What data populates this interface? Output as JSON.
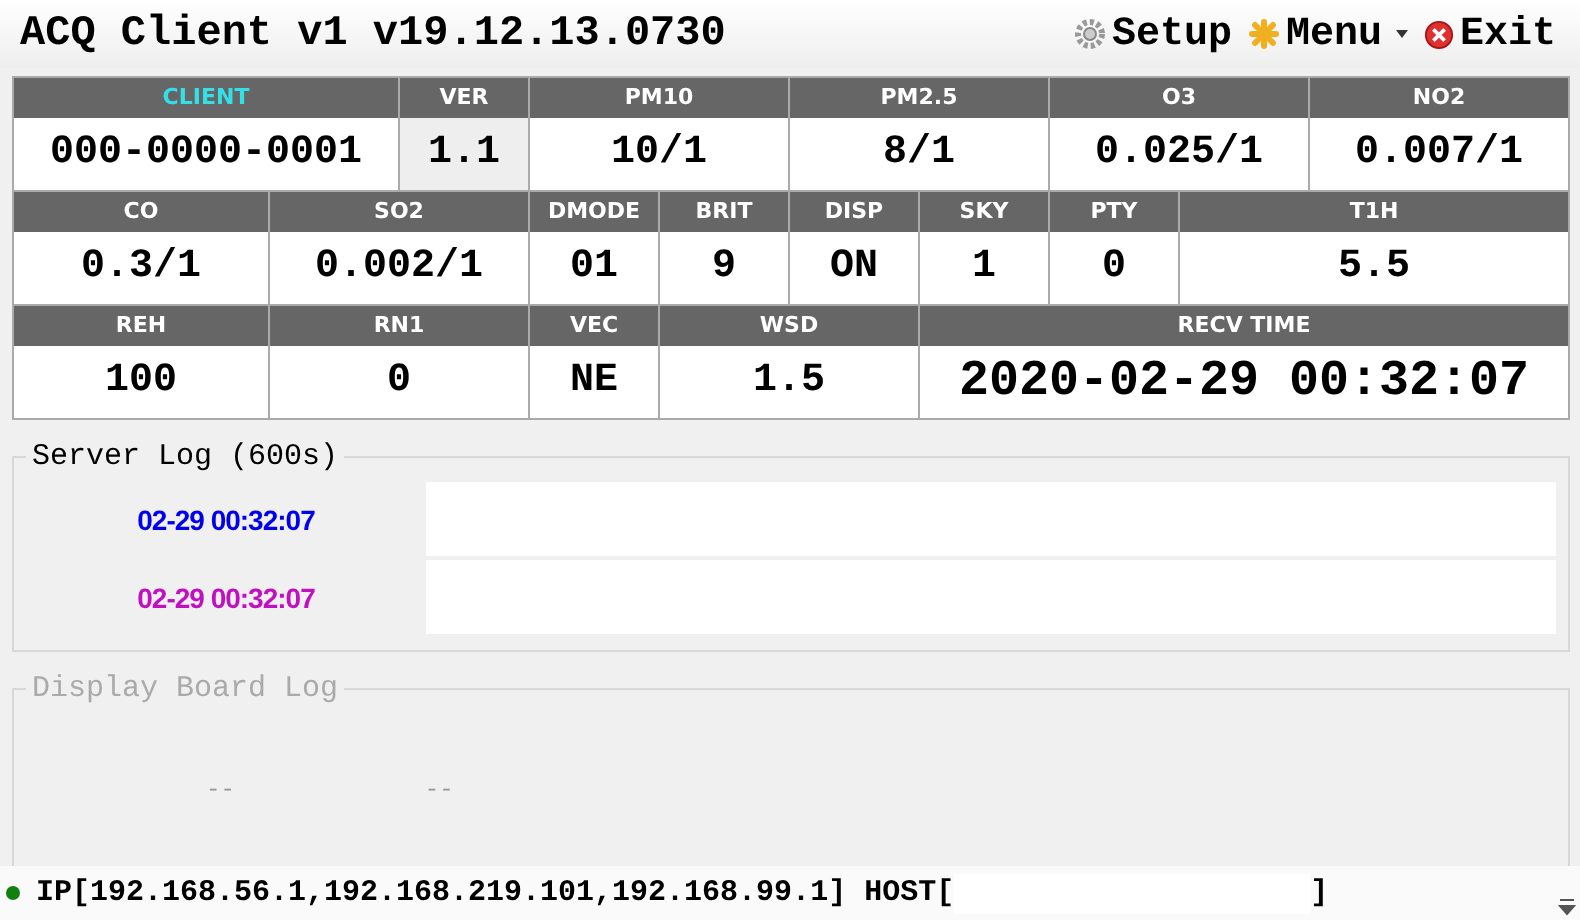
{
  "window": {
    "title": "ACQ Client v1 v19.12.13.0730"
  },
  "toolbar": [
    {
      "label": "Setup",
      "kind": "gear"
    },
    {
      "label": "Menu",
      "kind": "menu"
    },
    {
      "label": "Exit",
      "kind": "exit"
    }
  ],
  "grid": [
    [
      {
        "label": "CLIENT",
        "value": "000-0000-0001",
        "accent": true,
        "shaded": false,
        "kind": "value"
      },
      {
        "label": "VER",
        "value": "1.1",
        "accent": false,
        "shaded": true,
        "kind": "value"
      },
      {
        "label": "PM10",
        "value": "10/1",
        "accent": false,
        "shaded": false,
        "kind": "value"
      },
      {
        "label": "PM2.5",
        "value": "8/1",
        "accent": false,
        "shaded": false,
        "kind": "value"
      },
      {
        "label": "O3",
        "value": "0.025/1",
        "accent": false,
        "shaded": false,
        "kind": "value"
      },
      {
        "label": "NO2",
        "value": "0.007/1",
        "accent": false,
        "shaded": false,
        "kind": "value"
      }
    ],
    [
      {
        "label": "CO",
        "value": "0.3/1",
        "accent": false,
        "shaded": false,
        "kind": "value"
      },
      {
        "label": "SO2",
        "value": "0.002/1",
        "accent": false,
        "shaded": false,
        "kind": "value"
      },
      {
        "label": "DMODE",
        "value": "01",
        "accent": false,
        "shaded": false,
        "kind": "value"
      },
      {
        "label": "BRIT",
        "value": "9",
        "accent": false,
        "shaded": false,
        "kind": "value"
      },
      {
        "label": "DISP",
        "value": "ON",
        "accent": false,
        "shaded": false,
        "kind": "value"
      },
      {
        "label": "SKY",
        "value": "1",
        "accent": false,
        "shaded": false,
        "kind": "value"
      },
      {
        "label": "PTY",
        "value": "0",
        "accent": false,
        "shaded": false,
        "kind": "value"
      },
      {
        "label": "T1H",
        "value": "5.5",
        "accent": false,
        "shaded": false,
        "kind": "value"
      }
    ],
    [
      {
        "label": "REH",
        "value": "100",
        "accent": false,
        "shaded": false,
        "kind": "value"
      },
      {
        "label": "RN1",
        "value": "0",
        "accent": false,
        "shaded": false,
        "kind": "value"
      },
      {
        "label": "VEC",
        "value": "NE",
        "accent": false,
        "shaded": false,
        "kind": "value"
      },
      {
        "label": "WSD",
        "value": "1.5",
        "accent": false,
        "shaded": false,
        "kind": "value"
      },
      {
        "label": "RECV TIME",
        "value": "2020-02-29 00:32:07",
        "accent": false,
        "shaded": false,
        "kind": "time"
      }
    ]
  ],
  "server_log": {
    "title": "Server Log (600s)",
    "disabled": false,
    "entries": [
      {
        "time": "02-29 00:32:07",
        "color": "#0000ee"
      },
      {
        "time": "02-29 00:32:07",
        "color": "#c010c0"
      }
    ]
  },
  "display_board_log": {
    "title": "Display Board Log",
    "disabled": true,
    "items": [
      "--",
      "--"
    ]
  },
  "status_bar": {
    "connected": true,
    "text": "IP[192.168.56.1,192.168.219.101,192.168.99.1] HOST[",
    "suffix": "]"
  }
}
